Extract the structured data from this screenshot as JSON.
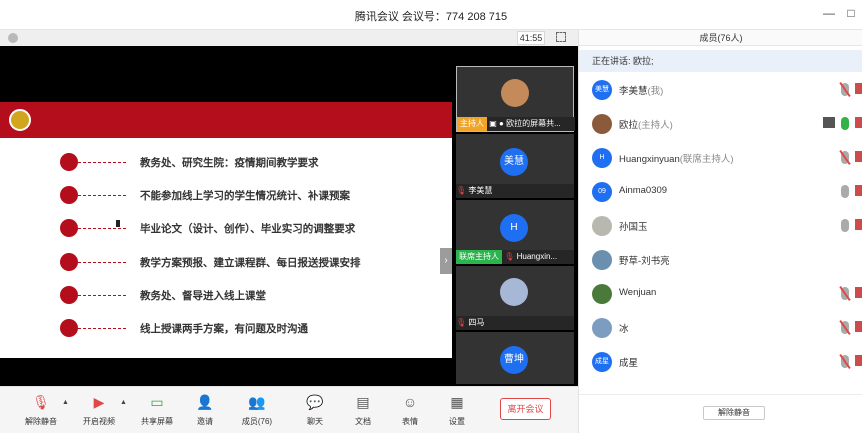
{
  "window": {
    "title": "腾讯会议 会议号：774 208 715",
    "minimize": "—",
    "maximize": "□"
  },
  "meeting": {
    "timer": "41:55"
  },
  "slide": {
    "items": [
      "教务处、研究生院：疫情期间教学要求",
      "不能参加线上学习的学生情况统计、补课预案",
      "毕业论文（设计、创作）、毕业实习的调整要求",
      "教学方案预报、建立课程群、每日报送授课安排",
      "教务处、督导进入线上课堂",
      "线上授课两手方案，有问题及时沟通"
    ]
  },
  "tiles": [
    {
      "badge": "主持人",
      "name": "欧拉的屏幕共...",
      "avatar": "",
      "avatar_color": "#c48a5a"
    },
    {
      "badge": "",
      "name": "李美慧",
      "avatar": "美慧",
      "avatar_color": "#1e6ff1"
    },
    {
      "badge": "联席主持人",
      "name": "Huangxin...",
      "avatar": "H",
      "avatar_color": "#1e6ff1"
    },
    {
      "badge": "",
      "name": "四马",
      "avatar": "",
      "avatar_color": "#a7b7d6"
    },
    {
      "badge": "",
      "name": "",
      "avatar": "曹坤",
      "avatar_color": "#1e6ff1"
    }
  ],
  "toolbar": {
    "mute": "解除静音",
    "video": "开启视频",
    "share": "共享屏幕",
    "invite": "邀请",
    "members": "成员(76)",
    "chat": "聊天",
    "docs": "文档",
    "emoji": "表情",
    "settings": "设置",
    "leave": "离开会议"
  },
  "panel": {
    "title": "成员(76人)",
    "speaking": "正在讲话: 欧拉;",
    "unmute_all": "解除静音",
    "members": [
      {
        "avatar": "美慧",
        "color": "#1e6ff1",
        "name": "李美慧",
        "role": "(我)",
        "mic": "muted"
      },
      {
        "avatar": "",
        "color": "#8a5a3a",
        "name": "欧拉",
        "role": "(主持人)",
        "mic": "on"
      },
      {
        "avatar": "H",
        "color": "#1e6ff1",
        "name": "Huangxinyuan",
        "role": "(联席主持人)",
        "mic": "muted"
      },
      {
        "avatar": "09",
        "color": "#1e6ff1",
        "name": "Ainma0309",
        "role": "",
        "mic": "plain"
      },
      {
        "avatar": "",
        "color": "#b8b8b0",
        "name": "孙国玉",
        "role": "",
        "mic": "plain"
      },
      {
        "avatar": "",
        "color": "#6b8fae",
        "name": "野草-刘书亮",
        "role": "",
        "mic": "none"
      },
      {
        "avatar": "",
        "color": "#4a7a3a",
        "name": "Wenjuan",
        "role": "",
        "mic": "muted"
      },
      {
        "avatar": "",
        "color": "#7c9cc0",
        "name": "冰",
        "role": "",
        "mic": "muted"
      },
      {
        "avatar": "成星",
        "color": "#1e6ff1",
        "name": "成星",
        "role": "",
        "mic": "muted"
      }
    ]
  }
}
